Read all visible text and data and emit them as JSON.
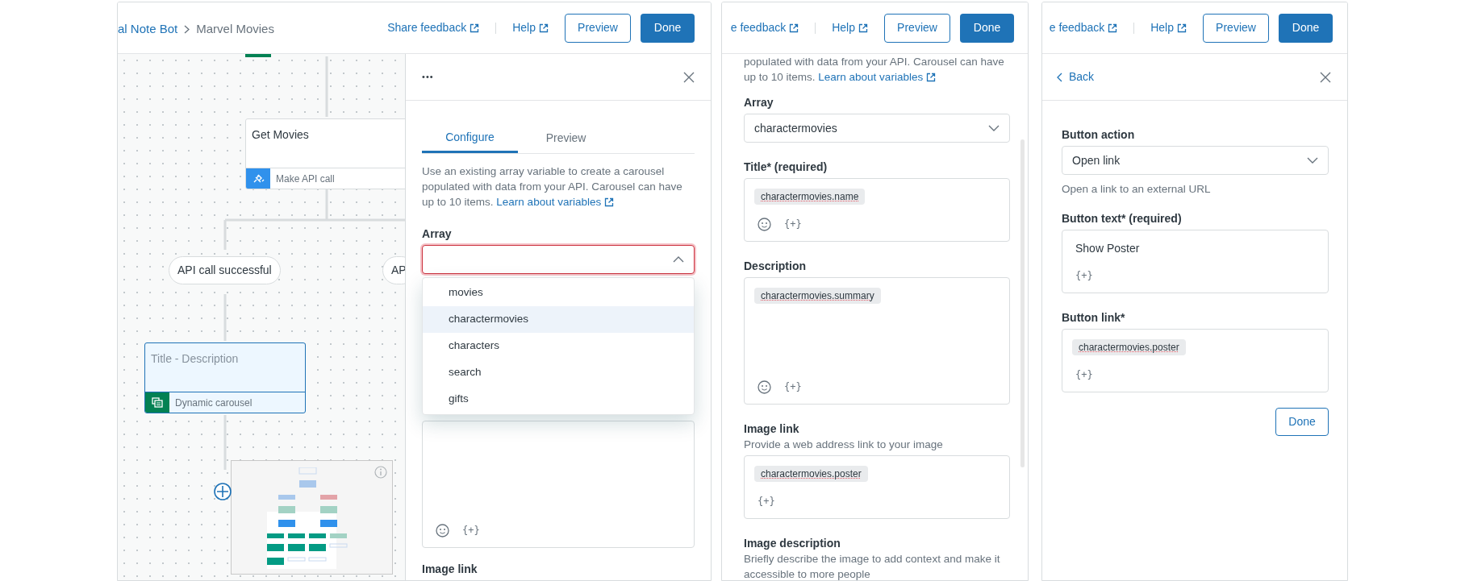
{
  "screens": [
    {
      "kind": "flow_editor",
      "header": {
        "breadcrumb": [
          "al Note Bot",
          "Marvel Movies"
        ],
        "share": "Share feedback",
        "help": "Help",
        "preview": "Preview",
        "done": "Done"
      },
      "canvas": {
        "nodes": [
          {
            "title": "Get Movies",
            "type_label": "Make API call",
            "selected": false
          },
          {
            "title": "Title - Description",
            "type_label": "Dynamic carousel",
            "selected": true
          }
        ],
        "pills": [
          "API call successful",
          "AP"
        ]
      },
      "panel": {
        "more": "•••",
        "tabs": [
          {
            "label": "Configure",
            "selected": true
          },
          {
            "label": "Preview",
            "selected": false
          }
        ],
        "intro": {
          "text": "Use an existing array variable to create a carousel populated with data from your API. Carousel can have up to 10 items.",
          "link": "Learn about variables"
        },
        "fields": [
          {
            "kind": "select",
            "label": "Array",
            "error": true,
            "expanded": true,
            "options": [
              {
                "label": "movies",
                "selected": false
              },
              {
                "label": "charactermovies",
                "selected": true
              },
              {
                "label": "characters",
                "selected": false
              },
              {
                "label": "search",
                "selected": false
              },
              {
                "label": "gifts",
                "selected": false
              }
            ]
          },
          {
            "kind": "editor_large",
            "emoji": true,
            "insert": "{+}"
          },
          {
            "kind": "label_only",
            "label": "Image link"
          }
        ]
      }
    },
    {
      "kind": "settings",
      "header": {
        "share": "e feedback",
        "help": "Help",
        "preview": "Preview",
        "done": "Done"
      },
      "intro": {
        "text": "populated with data from your API. Carousel can have up to 10 items.",
        "link": "Learn about variables"
      },
      "fields": [
        {
          "kind": "select",
          "label": "Array",
          "value": "charactermovies",
          "error": false,
          "expanded": false
        },
        {
          "kind": "editor",
          "label": "Title* (required)",
          "chip": "charactermovies.name",
          "emoji": true,
          "insert": "{+}"
        },
        {
          "kind": "editor_large",
          "label": "Description",
          "chip": "charactermovies.summary",
          "emoji": true,
          "insert": "{+}"
        },
        {
          "kind": "editor",
          "label": "Image link",
          "hint": "Provide a web address link to your image",
          "chip": "charactermovies.poster",
          "emoji": false,
          "insert": "{+}"
        },
        {
          "kind": "label_only",
          "label": "Image description",
          "hint": "Briefly describe the image to add context and make it accessible to more people"
        }
      ]
    },
    {
      "kind": "button_settings",
      "header": {
        "share": "e feedback",
        "help": "Help",
        "preview": "Preview",
        "done": "Done"
      },
      "back": "Back",
      "fields": [
        {
          "kind": "select",
          "label": "Button action",
          "value": "Open link",
          "error": false,
          "expanded": false,
          "hint": "Open a link to an external URL"
        },
        {
          "kind": "editor",
          "label": "Button text* (required)",
          "text": "Show Poster",
          "emoji": false,
          "insert": "{+}"
        },
        {
          "kind": "editor",
          "label": "Button link*",
          "chip": "charactermovies.poster",
          "emoji": false,
          "insert": "{+}"
        }
      ],
      "done": "Done"
    }
  ]
}
